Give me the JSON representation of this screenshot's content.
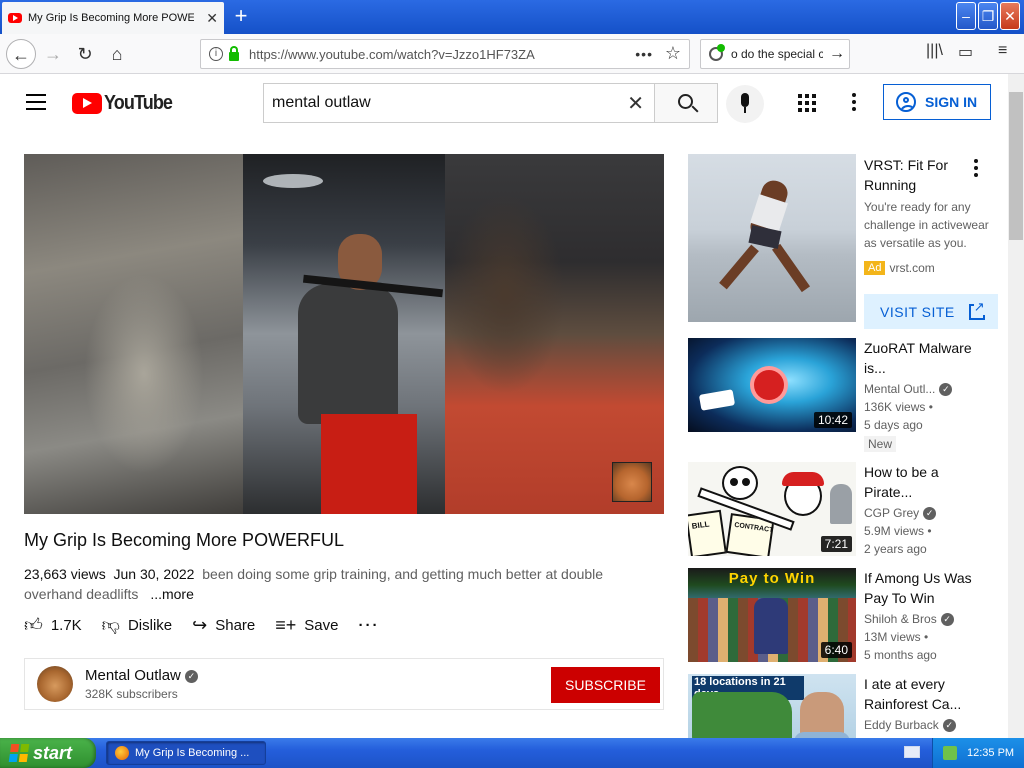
{
  "browser": {
    "tab_title": "My Grip Is Becoming More POWERFUL - YouTube",
    "tab_close": "✕",
    "new_tab": "+",
    "url": "https://www.youtube.com/watch?v=Jzzo1HF73ZA",
    "search_text": "o do the special c",
    "window_min": "–",
    "window_max": "❐",
    "window_close": "✕"
  },
  "header": {
    "logo_text": "YouTube",
    "search_value": "mental outlaw",
    "clear_icon": "✕",
    "sign_in": "SIGN IN"
  },
  "video": {
    "title": "My Grip Is Becoming More POWERFUL",
    "views": "23,663 views",
    "date": "Jun 30, 2022",
    "description": "been doing some grip training, and getting much better at double overhand deadlifts",
    "more": "...more",
    "likes": "1.7K",
    "dislike": "Dislike",
    "share": "Share",
    "save": "Save",
    "more_actions": "···"
  },
  "channel": {
    "name": "Mental Outlaw",
    "subscribers": "328K subscribers",
    "subscribe": "SUBSCRIBE"
  },
  "ad": {
    "title": "VRST: Fit For Running",
    "description": "You're ready for any challenge in activewear as versatile as you.",
    "badge": "Ad",
    "domain": "vrst.com",
    "visit": "VISIT SITE"
  },
  "recommendations": [
    {
      "title": "ZuoRAT Malware is...",
      "channel": "Mental Outl...",
      "views": "136K views •",
      "age": "5 days ago",
      "duration": "10:42",
      "badge": "New"
    },
    {
      "title": "How to be a Pirate...",
      "channel": "CGP Grey",
      "views": "5.9M views •",
      "age": "2 years ago",
      "duration": "7:21",
      "thumb_text_1": "BILL",
      "thumb_text_2": "CONTRACT"
    },
    {
      "title": "If Among Us Was Pay To Win",
      "channel": "Shiloh & Bros",
      "views": "13M views •",
      "age": "5 months ago",
      "duration": "6:40",
      "thumb_text": "Pay to Win"
    },
    {
      "title": "I ate at every Rainforest Ca...",
      "channel": "Eddy Burback",
      "thumb_text": "18 locations in 21 days"
    }
  ],
  "taskbar": {
    "start": "start",
    "task": "My Grip Is Becoming ...",
    "clock": "12:35 PM"
  },
  "icons": {
    "back": "back-arrow-icon",
    "forward": "forward-arrow-icon",
    "reload": "reload-icon",
    "home": "home-icon",
    "library": "library-icon",
    "sidebar": "sidebar-icon",
    "menu": "menu-icon"
  }
}
